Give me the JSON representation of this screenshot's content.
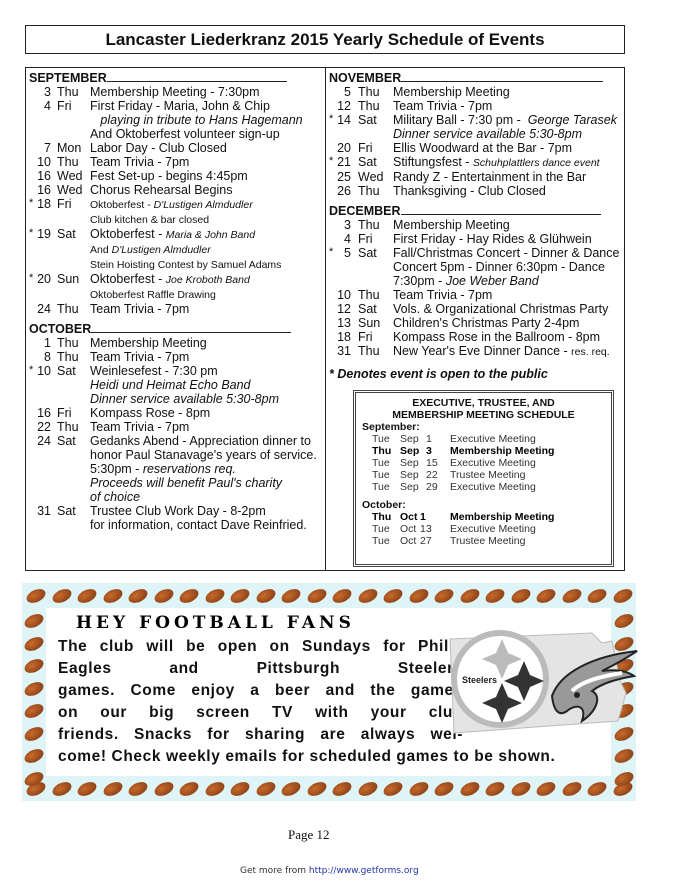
{
  "title": "Lancaster Liederkranz  2015 Yearly Schedule of Events",
  "left_months": [
    {
      "name": "SEPTEMBER",
      "events": [
        {
          "star": "",
          "day": "3",
          "dow": "Thu",
          "lines": [
            [
              {
                "t": "Membership Meeting - 7:30pm"
              }
            ]
          ]
        },
        {
          "star": "",
          "day": "4",
          "dow": "Fri",
          "lines": [
            [
              {
                "t": "First Friday - Maria, John & Chip"
              }
            ],
            [
              {
                "t": "   playing in tribute to Hans Hagemann",
                "i": true
              }
            ],
            [
              {
                "t": "And Oktoberfest volunteer sign-up"
              }
            ]
          ]
        },
        {
          "star": "",
          "day": "7",
          "dow": "Mon",
          "lines": [
            [
              {
                "t": "Labor Day - Club Closed"
              }
            ]
          ]
        },
        {
          "star": "",
          "day": "10",
          "dow": "Thu",
          "lines": [
            [
              {
                "t": "Team Trivia - 7pm"
              }
            ]
          ]
        },
        {
          "star": "",
          "day": "16",
          "dow": "Wed",
          "lines": [
            [
              {
                "t": "Fest Set-up - begins 4:45pm"
              }
            ]
          ]
        },
        {
          "star": "",
          "day": "16",
          "dow": "Wed",
          "lines": [
            [
              {
                "t": "Chorus Rehearsal Begins"
              }
            ]
          ]
        },
        {
          "star": "*",
          "day": "18",
          "dow": "Fri",
          "lines": [
            [
              {
                "t": "Oktoberfest - ",
                "s": true
              },
              {
                "t": "D'Lustigen Almdudler",
                "i": true,
                "s": true
              }
            ],
            [
              {
                "t": "Club kitchen & bar closed",
                "s": true
              }
            ]
          ]
        },
        {
          "star": "*",
          "day": "19",
          "dow": "Sat",
          "lines": [
            [
              {
                "t": "Oktoberfest - "
              },
              {
                "t": "Maria & John Band",
                "i": true,
                "s": true
              }
            ],
            [
              {
                "t": "And ",
                "s": true
              },
              {
                "t": "D'Lustigen Almdudler",
                "i": true,
                "s": true
              }
            ],
            [
              {
                "t": "Stein Hoisting Contest by Samuel Adams",
                "s": true
              }
            ]
          ]
        },
        {
          "star": "*",
          "day": "20",
          "dow": "Sun",
          "lines": [
            [
              {
                "t": "Oktoberfest - "
              },
              {
                "t": "Joe Kroboth Band",
                "i": true,
                "s": true
              }
            ],
            [
              {
                "t": "Oktoberfest Raffle Drawing",
                "s": true
              }
            ]
          ]
        },
        {
          "star": "",
          "day": "24",
          "dow": "Thu",
          "lines": [
            [
              {
                "t": "Team Trivia - 7pm"
              }
            ]
          ]
        }
      ]
    },
    {
      "name": "OCTOBER",
      "events": [
        {
          "star": "",
          "day": "1",
          "dow": "Thu",
          "lines": [
            [
              {
                "t": "Membership Meeting"
              }
            ]
          ]
        },
        {
          "star": "",
          "day": "8",
          "dow": "Thu",
          "lines": [
            [
              {
                "t": "Team Trivia - 7pm"
              }
            ]
          ]
        },
        {
          "star": "*",
          "day": "10",
          "dow": "Sat",
          "lines": [
            [
              {
                "t": "Weinlesefest - 7:30 pm"
              }
            ],
            [
              {
                "t": "Heidi und Heimat Echo Band",
                "i": true
              }
            ],
            [
              {
                "t": "Dinner service available 5:30-8pm",
                "i": true
              }
            ]
          ]
        },
        {
          "star": "",
          "day": "16",
          "dow": "Fri",
          "lines": [
            [
              {
                "t": "Kompass Rose - 8pm"
              }
            ]
          ]
        },
        {
          "star": "",
          "day": "22",
          "dow": "Thu",
          "lines": [
            [
              {
                "t": "Team Trivia - 7pm"
              }
            ]
          ]
        },
        {
          "star": "",
          "day": "24",
          "dow": "Sat",
          "lines": [
            [
              {
                "t": "Gedanks Abend - Appreciation dinner to"
              }
            ],
            [
              {
                "t": "honor Paul Stanavage's years of service."
              }
            ],
            [
              {
                "t": "5:30pm - "
              },
              {
                "t": "reservations req.",
                "i": true
              }
            ],
            [
              {
                "t": "Proceeds will benefit Paul's charity",
                "i": true
              }
            ],
            [
              {
                "t": "of choice",
                "i": true
              }
            ]
          ]
        },
        {
          "star": "",
          "day": "31",
          "dow": "Sat",
          "lines": [
            [
              {
                "t": "Trustee Club Work Day - 8-2pm"
              }
            ],
            [
              {
                "t": "for information, contact Dave Reinfried."
              }
            ]
          ]
        }
      ]
    }
  ],
  "right_months": [
    {
      "name": "NOVEMBER",
      "events": [
        {
          "star": "",
          "day": "5",
          "dow": "Thu",
          "lines": [
            [
              {
                "t": "Membership Meeting"
              }
            ]
          ]
        },
        {
          "star": "",
          "day": "12",
          "dow": "Thu",
          "lines": [
            [
              {
                "t": "Team Trivia - 7pm"
              }
            ]
          ]
        },
        {
          "star": "*",
          "day": "14",
          "dow": "Sat",
          "lines": [
            [
              {
                "t": "Military Ball - 7:30 pm -  "
              },
              {
                "t": "George Tarasek",
                "i": true
              }
            ],
            [
              {
                "t": "Dinner service available 5:30-8pm",
                "i": true
              }
            ]
          ]
        },
        {
          "star": "",
          "day": "20",
          "dow": "Fri",
          "lines": [
            [
              {
                "t": "Ellis Woodward at the Bar - 7pm"
              }
            ]
          ]
        },
        {
          "star": "*",
          "day": "21",
          "dow": "Sat",
          "lines": [
            [
              {
                "t": "Stiftungsfest - "
              },
              {
                "t": "Schuhplattlers dance event",
                "i": true,
                "s": true
              }
            ]
          ]
        },
        {
          "star": "",
          "day": "25",
          "dow": "Wed",
          "lines": [
            [
              {
                "t": "Randy Z - Entertainment in the Bar"
              }
            ]
          ]
        },
        {
          "star": "",
          "day": "26",
          "dow": "Thu",
          "lines": [
            [
              {
                "t": "Thanksgiving - Club Closed"
              }
            ]
          ]
        }
      ]
    },
    {
      "name": "DECEMBER",
      "events": [
        {
          "star": "",
          "day": "3",
          "dow": "Thu",
          "lines": [
            [
              {
                "t": "Membership Meeting"
              }
            ]
          ]
        },
        {
          "star": "",
          "day": "4",
          "dow": "Fri",
          "lines": [
            [
              {
                "t": "First Friday - Hay Rides & Glühwein"
              }
            ]
          ]
        },
        {
          "star": "*",
          "day": "5",
          "dow": "Sat",
          "lines": [
            [
              {
                "t": "Fall/Christmas Concert - Dinner & Dance"
              }
            ],
            [
              {
                "t": "Concert 5pm - Dinner 6:30pm - Dance"
              }
            ],
            [
              {
                "t": "7:30pm - "
              },
              {
                "t": "Joe Weber Band",
                "i": true
              }
            ]
          ]
        },
        {
          "star": "",
          "day": "10",
          "dow": "Thu",
          "lines": [
            [
              {
                "t": "Team Trivia - 7pm"
              }
            ]
          ]
        },
        {
          "star": "",
          "day": "12",
          "dow": "Sat",
          "lines": [
            [
              {
                "t": "Vols. & Organizational Christmas Party"
              }
            ]
          ]
        },
        {
          "star": "",
          "day": "13",
          "dow": "Sun",
          "lines": [
            [
              {
                "t": "Children's Christmas Party 2-4pm"
              }
            ]
          ]
        },
        {
          "star": "",
          "day": "18",
          "dow": "Fri",
          "lines": [
            [
              {
                "t": "Kompass Rose in the Ballroom - 8pm"
              }
            ]
          ]
        },
        {
          "star": "",
          "day": "31",
          "dow": "Thu",
          "lines": [
            [
              {
                "t": "New Year's Eve Dinner Dance - "
              },
              {
                "t": "res. req.",
                "s": true
              }
            ]
          ]
        }
      ]
    }
  ],
  "public_note": "* Denotes event is open to the public",
  "meetings": {
    "title_line1": "EXECUTIVE, TRUSTEE, AND",
    "title_line2": "MEMBERSHIP MEETING SCHEDULE",
    "groups": [
      {
        "month": "September:",
        "rows": [
          {
            "dow": "Tue",
            "mon": "Sep",
            "day": "1",
            "type": "Executive Meeting",
            "bold": false
          },
          {
            "dow": "Thu",
            "mon": "Sep",
            "day": "3",
            "type": "Membership Meeting",
            "bold": true
          },
          {
            "dow": "Tue",
            "mon": "Sep",
            "day": "15",
            "type": "Executive Meeting",
            "bold": false
          },
          {
            "dow": "Tue",
            "mon": "Sep",
            "day": "22",
            "type": "Trustee Meeting",
            "bold": false
          },
          {
            "dow": "Tue",
            "mon": "Sep",
            "day": "29",
            "type": "Executive Meeting",
            "bold": false
          }
        ]
      },
      {
        "month": "October:",
        "rows": [
          {
            "dow": "Thu",
            "mon": "Oct",
            "day": "1",
            "type": "Membership Meeting",
            "bold": true
          },
          {
            "dow": "Tue",
            "mon": "Oct",
            "day": "13",
            "type": "Executive Meeting",
            "bold": false
          },
          {
            "dow": "Tue",
            "mon": "Oct",
            "day": "27",
            "type": "Trustee Meeting",
            "bold": false
          }
        ]
      }
    ]
  },
  "football": {
    "title": "HEY FOOTBALL FANS",
    "lines": [
      "The club will be open on Sundays for Philly",
      "Eagles and Pittsburgh Steelers",
      "games. Come enjoy a beer and the games",
      "on our big screen TV with your club",
      "friends. Snacks for sharing are always wel-",
      "come! Check weekly emails for scheduled games to be shown."
    ],
    "logo_text": "Steelers",
    "border_color": "#dff4f7",
    "ball_color": "#a0481a"
  },
  "page_label": "Page 12",
  "footer": {
    "prefix": "Get more from ",
    "link": "http://www.getforms.org"
  }
}
